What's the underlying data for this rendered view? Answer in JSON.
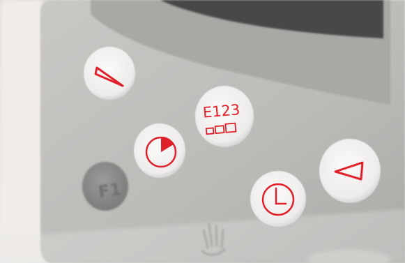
{
  "panel": {
    "buttons": [
      {
        "id": "decrease",
        "icon": "decrease-wedge-icon"
      },
      {
        "id": "program",
        "text": "E123",
        "icon": "program-level-bars-icon"
      },
      {
        "id": "start-timer",
        "icon": "timer-dial-icon"
      },
      {
        "id": "clock",
        "icon": "clock-icon"
      },
      {
        "id": "increase",
        "icon": "increase-wedge-icon"
      },
      {
        "id": "f1",
        "text": "F1"
      }
    ],
    "colors": {
      "panel": "#b9b9b6",
      "button_face": "#f2f0ef",
      "symbol": "#e0212b",
      "f1_button": "#8d8f8c",
      "display": "#4a4746"
    }
  }
}
